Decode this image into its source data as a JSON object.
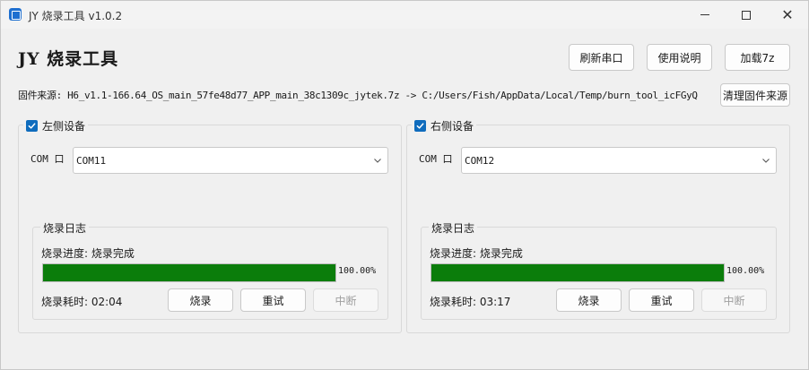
{
  "window": {
    "title": "JY 烧录工具 v1.0.2",
    "minimize_glyph": "",
    "close_glyph": "✕"
  },
  "header": {
    "app_title": "JY 烧录工具",
    "refresh_label": "刷新串口",
    "help_label": "使用说明",
    "load_label": "加载7z"
  },
  "source": {
    "text": "固件来源: H6_v1.1-166.64_OS_main_57fe48d77_APP_main_38c1309c_jytek.7z -> C:/Users/Fish/AppData/Local/Temp/burn_tool_icFGyQ",
    "clear_label": "清理固件来源"
  },
  "left": {
    "title": "左侧设备",
    "checked": true,
    "com_label": "COM 口",
    "com_value": "COM11",
    "log_title": "烧录日志",
    "progress_text": "烧录进度: 烧录完成",
    "progress_value": 100,
    "progress_pct": "100.00%",
    "elapsed_text": "烧录耗时: 02:04",
    "burn_label": "烧录",
    "retry_label": "重试",
    "stop_label": "中断"
  },
  "right": {
    "title": "右侧设备",
    "checked": true,
    "com_label": "COM 口",
    "com_value": "COM12",
    "log_title": "烧录日志",
    "progress_text": "烧录进度: 烧录完成",
    "progress_value": 100,
    "progress_pct": "100.00%",
    "elapsed_text": "烧录耗时: 03:17",
    "burn_label": "烧录",
    "retry_label": "重试",
    "stop_label": "中断"
  },
  "colors": {
    "accent": "#0f6cbd",
    "progress": "#0b7d0b",
    "app_icon": "#1e6fd0"
  },
  "icons": [
    "app-icon",
    "minimize-icon",
    "maximize-icon",
    "close-icon",
    "checkbox-checked-icon",
    "chevron-down-icon"
  ]
}
